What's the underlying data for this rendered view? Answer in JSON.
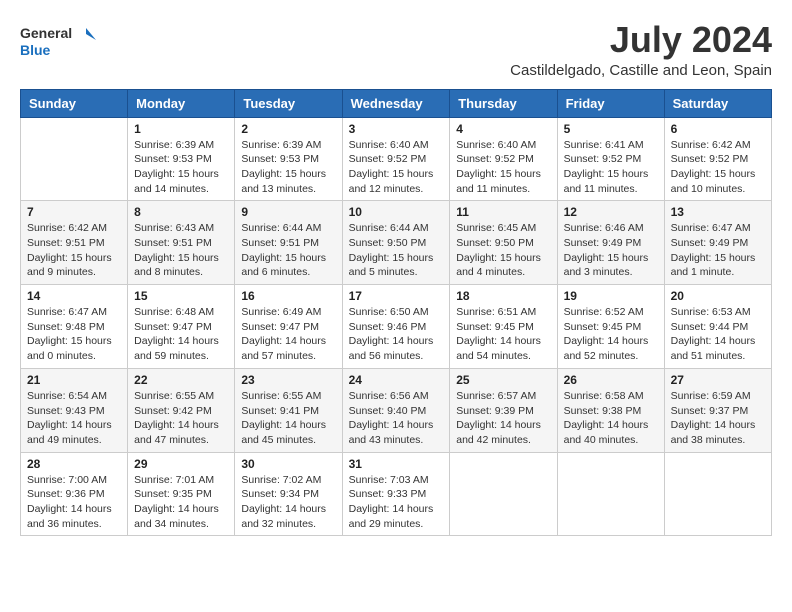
{
  "header": {
    "logo_general": "General",
    "logo_blue": "Blue",
    "main_title": "July 2024",
    "subtitle": "Castildelgado, Castille and Leon, Spain"
  },
  "days_of_week": [
    "Sunday",
    "Monday",
    "Tuesday",
    "Wednesday",
    "Thursday",
    "Friday",
    "Saturday"
  ],
  "weeks": [
    [
      {
        "day": "",
        "info": ""
      },
      {
        "day": "1",
        "info": "Sunrise: 6:39 AM\nSunset: 9:53 PM\nDaylight: 15 hours\nand 14 minutes."
      },
      {
        "day": "2",
        "info": "Sunrise: 6:39 AM\nSunset: 9:53 PM\nDaylight: 15 hours\nand 13 minutes."
      },
      {
        "day": "3",
        "info": "Sunrise: 6:40 AM\nSunset: 9:52 PM\nDaylight: 15 hours\nand 12 minutes."
      },
      {
        "day": "4",
        "info": "Sunrise: 6:40 AM\nSunset: 9:52 PM\nDaylight: 15 hours\nand 11 minutes."
      },
      {
        "day": "5",
        "info": "Sunrise: 6:41 AM\nSunset: 9:52 PM\nDaylight: 15 hours\nand 11 minutes."
      },
      {
        "day": "6",
        "info": "Sunrise: 6:42 AM\nSunset: 9:52 PM\nDaylight: 15 hours\nand 10 minutes."
      }
    ],
    [
      {
        "day": "7",
        "info": "Sunrise: 6:42 AM\nSunset: 9:51 PM\nDaylight: 15 hours\nand 9 minutes."
      },
      {
        "day": "8",
        "info": "Sunrise: 6:43 AM\nSunset: 9:51 PM\nDaylight: 15 hours\nand 8 minutes."
      },
      {
        "day": "9",
        "info": "Sunrise: 6:44 AM\nSunset: 9:51 PM\nDaylight: 15 hours\nand 6 minutes."
      },
      {
        "day": "10",
        "info": "Sunrise: 6:44 AM\nSunset: 9:50 PM\nDaylight: 15 hours\nand 5 minutes."
      },
      {
        "day": "11",
        "info": "Sunrise: 6:45 AM\nSunset: 9:50 PM\nDaylight: 15 hours\nand 4 minutes."
      },
      {
        "day": "12",
        "info": "Sunrise: 6:46 AM\nSunset: 9:49 PM\nDaylight: 15 hours\nand 3 minutes."
      },
      {
        "day": "13",
        "info": "Sunrise: 6:47 AM\nSunset: 9:49 PM\nDaylight: 15 hours\nand 1 minute."
      }
    ],
    [
      {
        "day": "14",
        "info": "Sunrise: 6:47 AM\nSunset: 9:48 PM\nDaylight: 15 hours\nand 0 minutes."
      },
      {
        "day": "15",
        "info": "Sunrise: 6:48 AM\nSunset: 9:47 PM\nDaylight: 14 hours\nand 59 minutes."
      },
      {
        "day": "16",
        "info": "Sunrise: 6:49 AM\nSunset: 9:47 PM\nDaylight: 14 hours\nand 57 minutes."
      },
      {
        "day": "17",
        "info": "Sunrise: 6:50 AM\nSunset: 9:46 PM\nDaylight: 14 hours\nand 56 minutes."
      },
      {
        "day": "18",
        "info": "Sunrise: 6:51 AM\nSunset: 9:45 PM\nDaylight: 14 hours\nand 54 minutes."
      },
      {
        "day": "19",
        "info": "Sunrise: 6:52 AM\nSunset: 9:45 PM\nDaylight: 14 hours\nand 52 minutes."
      },
      {
        "day": "20",
        "info": "Sunrise: 6:53 AM\nSunset: 9:44 PM\nDaylight: 14 hours\nand 51 minutes."
      }
    ],
    [
      {
        "day": "21",
        "info": "Sunrise: 6:54 AM\nSunset: 9:43 PM\nDaylight: 14 hours\nand 49 minutes."
      },
      {
        "day": "22",
        "info": "Sunrise: 6:55 AM\nSunset: 9:42 PM\nDaylight: 14 hours\nand 47 minutes."
      },
      {
        "day": "23",
        "info": "Sunrise: 6:55 AM\nSunset: 9:41 PM\nDaylight: 14 hours\nand 45 minutes."
      },
      {
        "day": "24",
        "info": "Sunrise: 6:56 AM\nSunset: 9:40 PM\nDaylight: 14 hours\nand 43 minutes."
      },
      {
        "day": "25",
        "info": "Sunrise: 6:57 AM\nSunset: 9:39 PM\nDaylight: 14 hours\nand 42 minutes."
      },
      {
        "day": "26",
        "info": "Sunrise: 6:58 AM\nSunset: 9:38 PM\nDaylight: 14 hours\nand 40 minutes."
      },
      {
        "day": "27",
        "info": "Sunrise: 6:59 AM\nSunset: 9:37 PM\nDaylight: 14 hours\nand 38 minutes."
      }
    ],
    [
      {
        "day": "28",
        "info": "Sunrise: 7:00 AM\nSunset: 9:36 PM\nDaylight: 14 hours\nand 36 minutes."
      },
      {
        "day": "29",
        "info": "Sunrise: 7:01 AM\nSunset: 9:35 PM\nDaylight: 14 hours\nand 34 minutes."
      },
      {
        "day": "30",
        "info": "Sunrise: 7:02 AM\nSunset: 9:34 PM\nDaylight: 14 hours\nand 32 minutes."
      },
      {
        "day": "31",
        "info": "Sunrise: 7:03 AM\nSunset: 9:33 PM\nDaylight: 14 hours\nand 29 minutes."
      },
      {
        "day": "",
        "info": ""
      },
      {
        "day": "",
        "info": ""
      },
      {
        "day": "",
        "info": ""
      }
    ]
  ]
}
